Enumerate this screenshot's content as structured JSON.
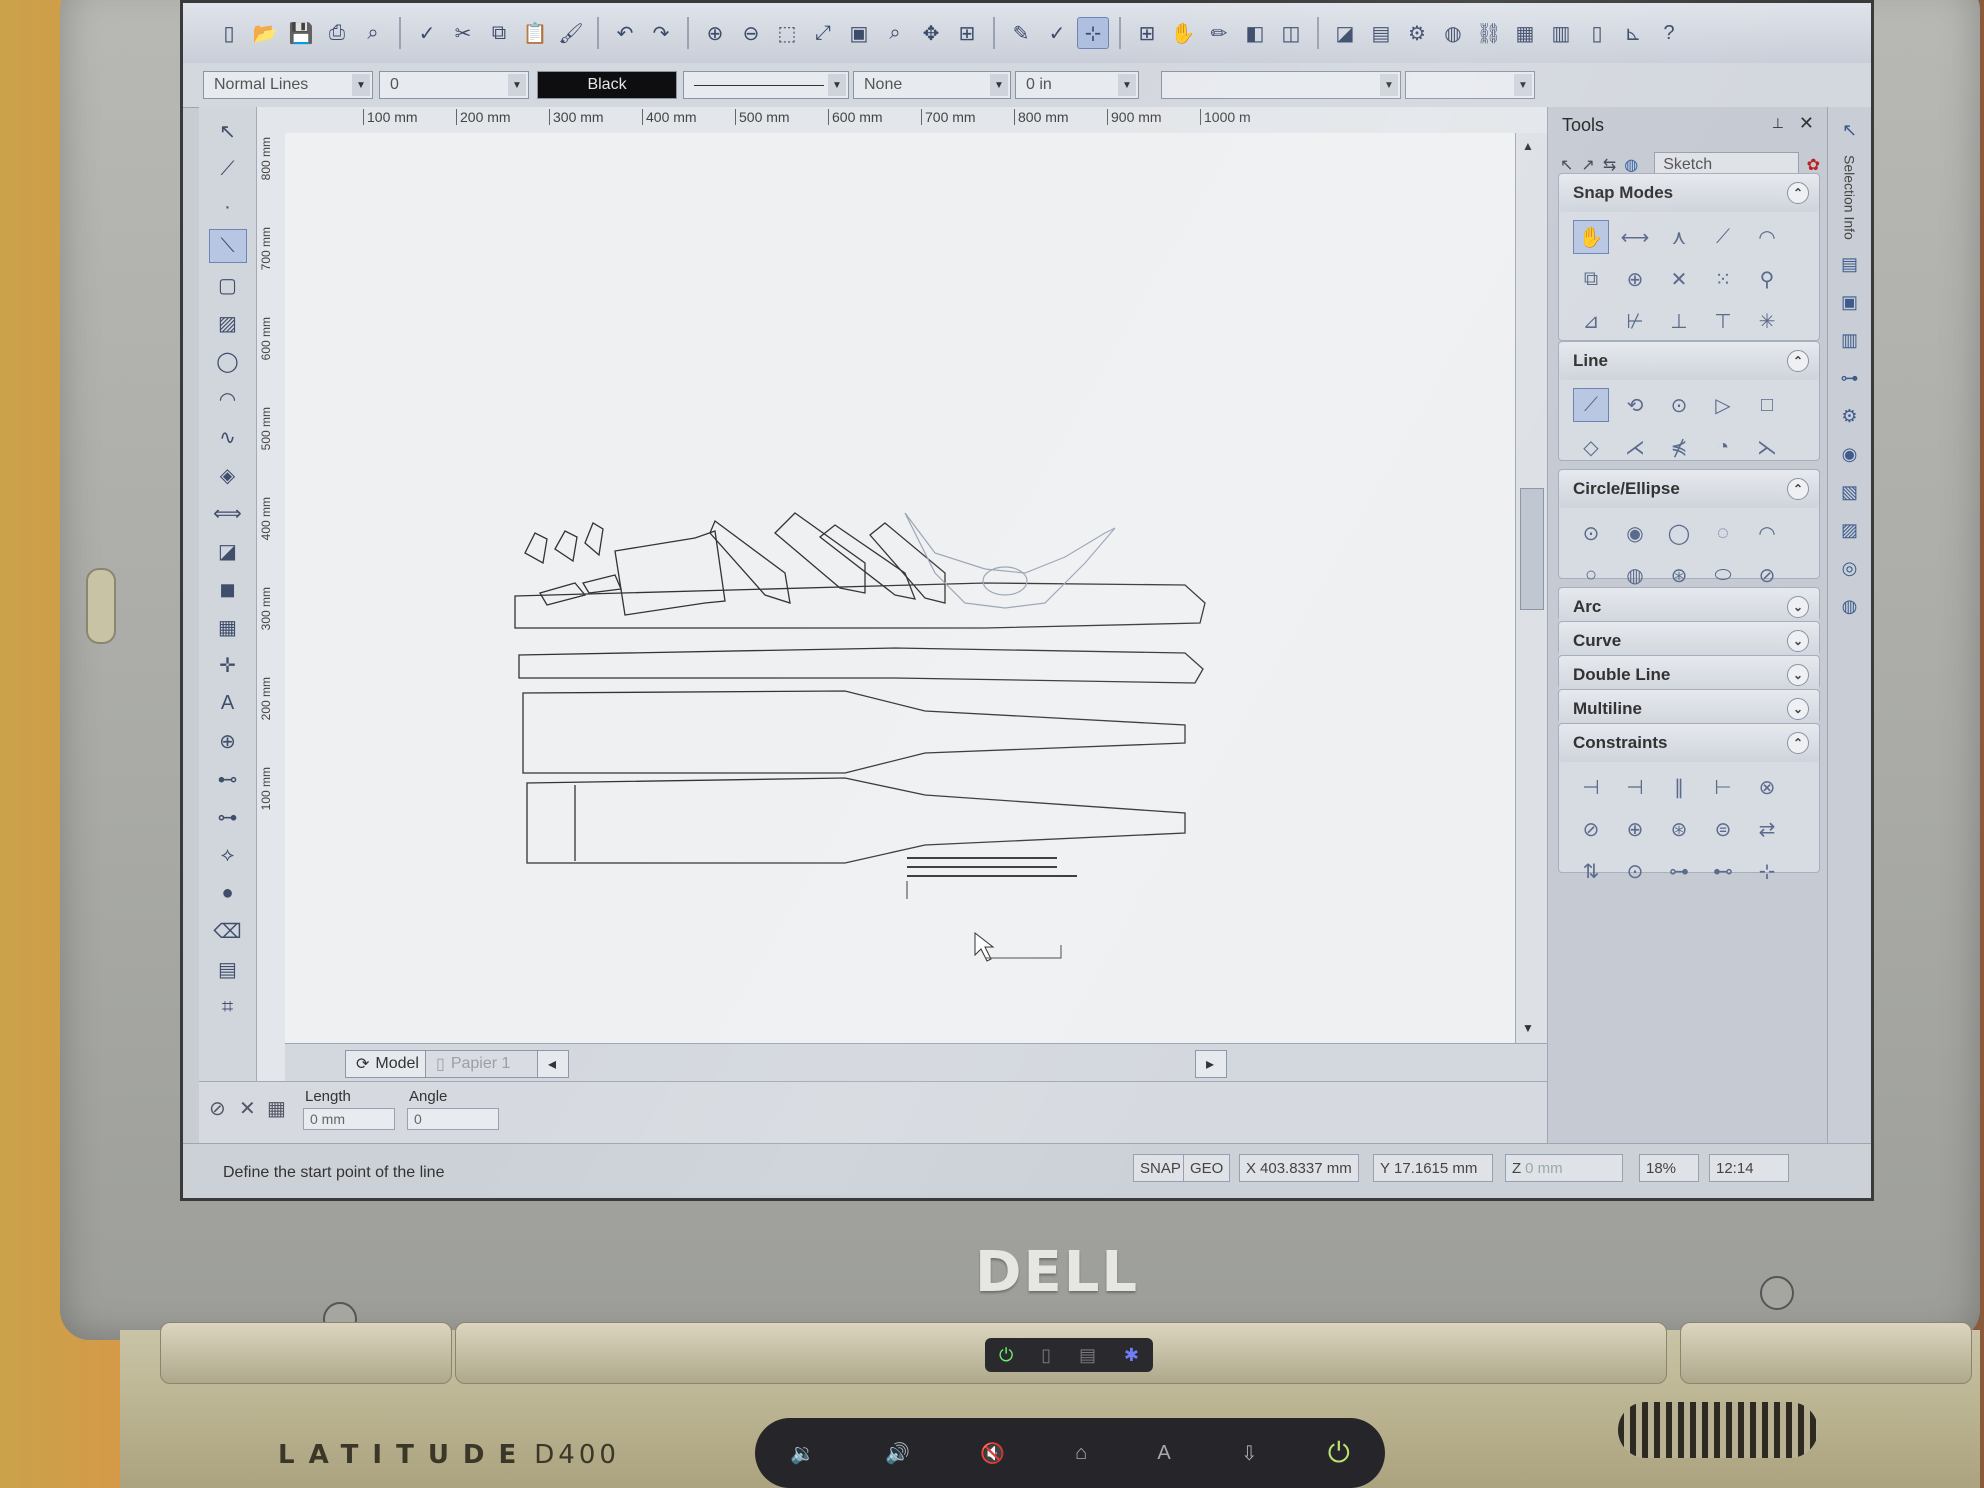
{
  "toolbar": {
    "icons": [
      "new-icon",
      "open-icon",
      "save-icon",
      "print-icon",
      "print-preview-icon",
      "spellcheck-icon",
      "cut-icon",
      "copy-icon",
      "paste-icon",
      "format-painter-icon",
      "undo-icon",
      "redo-icon",
      "zoom-in-icon",
      "zoom-out-icon",
      "zoom-window-icon",
      "zoom-extents-icon",
      "zoom-page-icon",
      "zoom-realtime-icon",
      "pan-icon",
      "fit-icon",
      "pen-icon",
      "spell-icon",
      "snap-icon",
      "grid-icon",
      "hand-icon",
      "pencil-icon",
      "render-icon",
      "view-icon",
      "cube-icon",
      "layers-icon",
      "explorer-icon",
      "globe-icon",
      "link-icon",
      "table-icon",
      "chart-icon",
      "page-icon",
      "ucs-icon",
      "help-icon"
    ]
  },
  "properties": {
    "line_style": "Normal Lines",
    "line_width": "0",
    "color": "Black",
    "arrow": "None",
    "offset": "0 in"
  },
  "ruler": {
    "h_labels": [
      "100 mm",
      "200 mm",
      "300 mm",
      "400 mm",
      "500 mm",
      "600 mm",
      "700 mm",
      "800 mm",
      "900 mm",
      "1000 m"
    ],
    "v_labels": [
      "800 mm",
      "700 mm",
      "600 mm",
      "500 mm",
      "400 mm",
      "300 mm",
      "200 mm",
      "100 mm"
    ]
  },
  "tabs": {
    "model": "Model",
    "paper": "Papier 1"
  },
  "inputs": {
    "length_label": "Length",
    "length_value": "0 mm",
    "angle_label": "Angle",
    "angle_value": "0"
  },
  "status": {
    "prompt": "Define the start point of the line",
    "snap": "SNAP",
    "geo": "GEO",
    "x": "403.8337 mm",
    "y": "17.1615 mm",
    "z": "0 mm",
    "zoom": "18%",
    "time": "12:14"
  },
  "tools_panel": {
    "title": "Tools",
    "mode": "Sketch",
    "sections": [
      {
        "title": "Snap Modes",
        "expanded": true
      },
      {
        "title": "Line",
        "expanded": true
      },
      {
        "title": "Circle/Ellipse",
        "expanded": true
      },
      {
        "title": "Arc",
        "expanded": false
      },
      {
        "title": "Curve",
        "expanded": false
      },
      {
        "title": "Double Line",
        "expanded": false
      },
      {
        "title": "Multiline",
        "expanded": false
      },
      {
        "title": "Constraints",
        "expanded": true
      }
    ]
  },
  "side_strip": {
    "label": "Selection Info"
  },
  "laptop": {
    "logo": "DELL",
    "brand": "LATITUDE",
    "model": "D400"
  },
  "colors": {
    "canvas": "#eef0f2",
    "ui_bg": "#c5cad3",
    "highlight": "#b9c7e2"
  }
}
